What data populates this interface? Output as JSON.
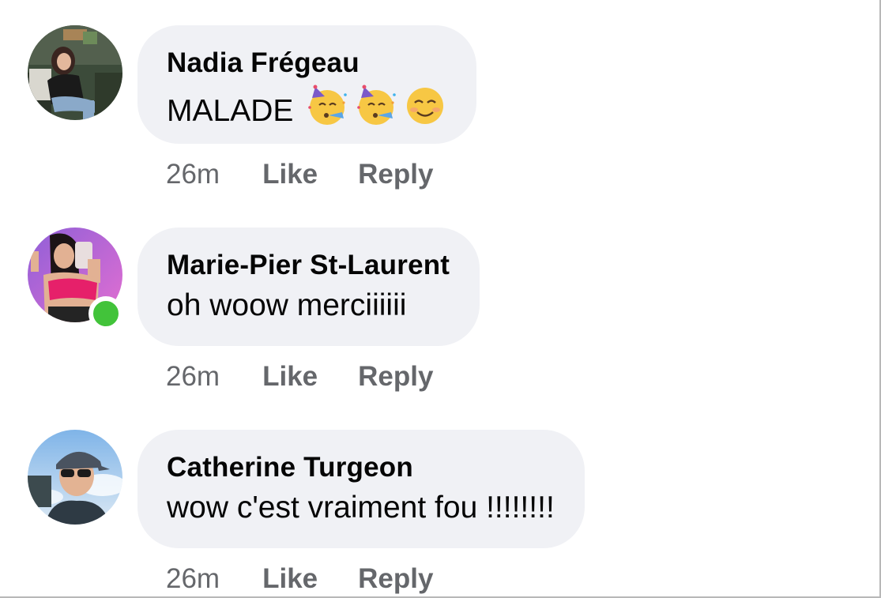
{
  "comments": [
    {
      "author": "Nadia Frégeau",
      "text": "MALADE",
      "emojis": [
        "partying-face-emoji",
        "partying-face-emoji",
        "smiling-face-emoji"
      ],
      "time": "26m",
      "like_label": "Like",
      "reply_label": "Reply",
      "online": false
    },
    {
      "author": "Marie-Pier St-Laurent",
      "text": "oh woow merciiiiii",
      "time": "26m",
      "like_label": "Like",
      "reply_label": "Reply",
      "online": true
    },
    {
      "author": "Catherine Turgeon",
      "text": "wow c'est vraiment fou !!!!!!!!",
      "time": "26m",
      "like_label": "Like",
      "reply_label": "Reply",
      "online": false
    }
  ],
  "colors": {
    "bubble": "#f0f1f5",
    "name_text": "#050505",
    "meta_text": "#65676b",
    "online_dot": "#42c33a"
  }
}
